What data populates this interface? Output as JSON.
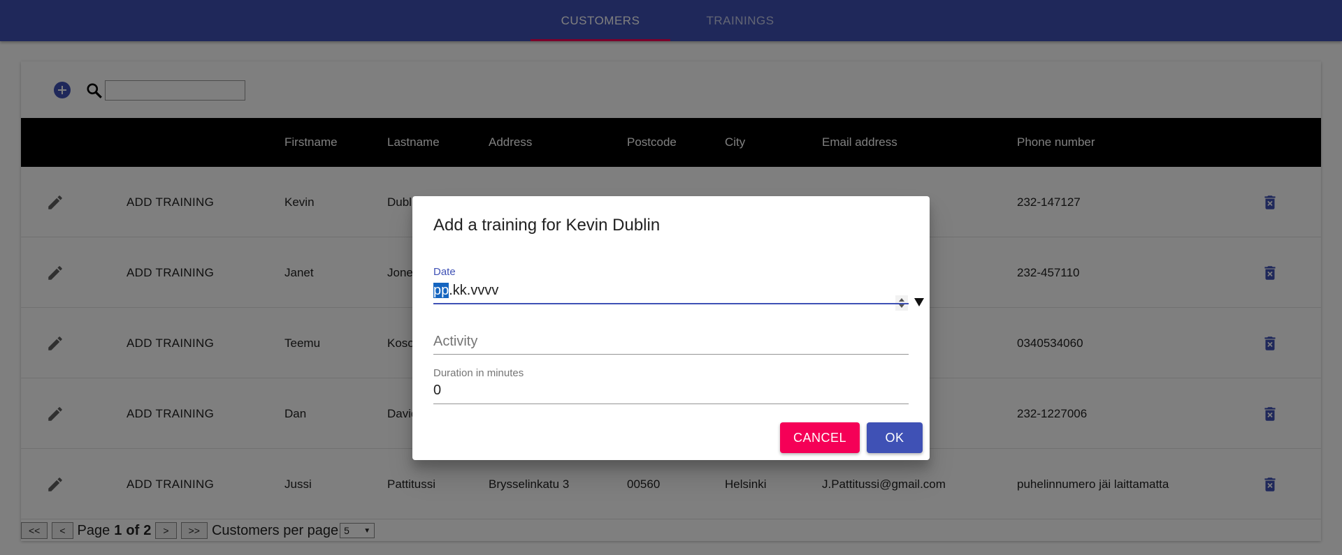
{
  "tabs": [
    {
      "label": "CUSTOMERS",
      "active": true
    },
    {
      "label": "TRAININGS",
      "active": false
    }
  ],
  "colors": {
    "primary": "#3f51b5",
    "secondary": "#f50057",
    "header_bg": "#000000",
    "overlay": "rgba(0,0,0,0.5)"
  },
  "toolbar": {
    "add_icon": "add-circle-icon",
    "search_icon": "search-icon",
    "search_value": ""
  },
  "table": {
    "columns": [
      "Firstname",
      "Lastname",
      "Address",
      "Postcode",
      "City",
      "Email address",
      "Phone number"
    ],
    "add_training_label": "ADD TRAINING",
    "row_icons": {
      "edit": "edit-pencil-icon",
      "delete": "delete-icon"
    },
    "rows": [
      {
        "firstname": "Kevin",
        "lastname": "Dublin",
        "address": "",
        "postcode": "",
        "city": "",
        "email": "",
        "phone": "232-147127"
      },
      {
        "firstname": "Janet",
        "lastname": "Jones",
        "address": "",
        "postcode": "",
        "city": "",
        "email": "",
        "phone": "232-457110"
      },
      {
        "firstname": "Teemu",
        "lastname": "Kosonen",
        "address": "",
        "postcode": "",
        "city": "",
        "email": "",
        "phone": "0340534060"
      },
      {
        "firstname": "Dan",
        "lastname": "David",
        "address": "",
        "postcode": "",
        "city": "",
        "email": "",
        "phone": "232-1227006"
      },
      {
        "firstname": "Jussi",
        "lastname": "Pattitussi",
        "address": "Brysselinkatu 3",
        "postcode": "00560",
        "city": "Helsinki",
        "email": "J.Pattitussi@gmail.com",
        "phone": "puhelinnumero jäi laittamatta"
      }
    ]
  },
  "pagination": {
    "first": "<<",
    "prev": "<",
    "next": ">",
    "last": ">>",
    "page_label": "Page",
    "current": "1",
    "of_label": "of",
    "total": "2",
    "per_page_label": "Customers per page",
    "per_page_value": "5"
  },
  "dialog": {
    "title": "Add a training for Kevin Dublin",
    "date_label": "Date",
    "date_seg_day": "pp",
    "date_seg_rest": ".kk.vvvv",
    "activity_placeholder": "Activity",
    "duration_label": "Duration in minutes",
    "duration_value": "0",
    "cancel_label": "CANCEL",
    "ok_label": "OK"
  }
}
